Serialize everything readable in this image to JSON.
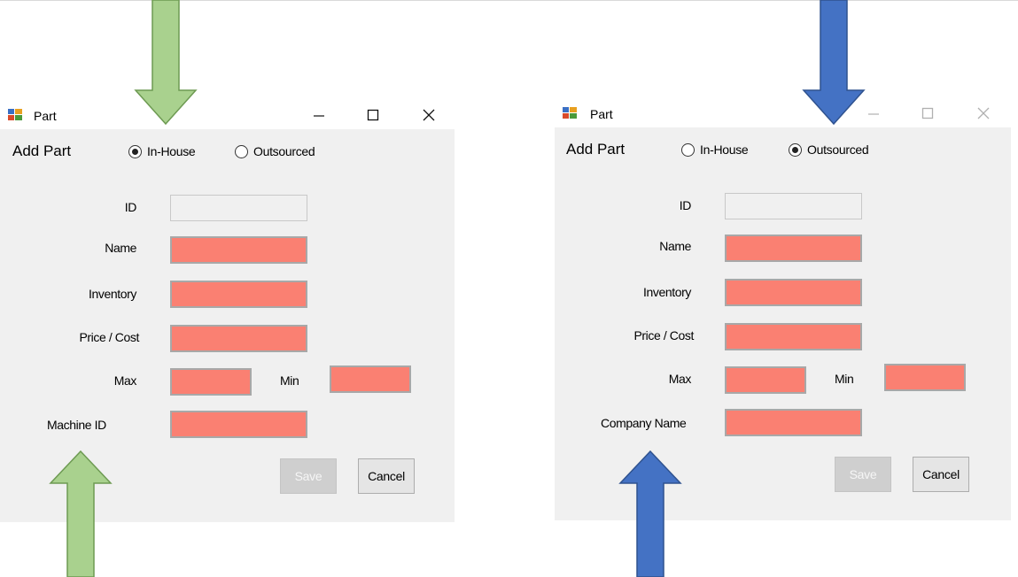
{
  "colors": {
    "arrow_left": "#a9d18e",
    "arrow_right": "#4472c4",
    "field_bg": "#fa8072",
    "client_bg": "#f0f0f0"
  },
  "left_window": {
    "title": "Part",
    "heading": "Add Part",
    "radio_inhouse": "In-House",
    "radio_outsourced": "Outsourced",
    "selected": "In-House",
    "labels": {
      "id": "ID",
      "name": "Name",
      "inventory": "Inventory",
      "price": "Price / Cost",
      "max": "Max",
      "min": "Min",
      "extra": "Machine ID"
    },
    "save_label": "Save",
    "cancel_label": "Cancel"
  },
  "right_window": {
    "title": "Part",
    "heading": "Add Part",
    "radio_inhouse": "In-House",
    "radio_outsourced": "Outsourced",
    "selected": "Outsourced",
    "labels": {
      "id": "ID",
      "name": "Name",
      "inventory": "Inventory",
      "price": "Price / Cost",
      "max": "Max",
      "min": "Min",
      "extra": "Company Name"
    },
    "save_label": "Save",
    "cancel_label": "Cancel"
  },
  "icons": {
    "window_minimize": "minimize-icon",
    "window_maximize": "maximize-icon",
    "window_close": "close-icon",
    "app_icon": "form-app-icon",
    "arrow_down": "down-arrow-icon",
    "arrow_up": "up-arrow-icon"
  }
}
